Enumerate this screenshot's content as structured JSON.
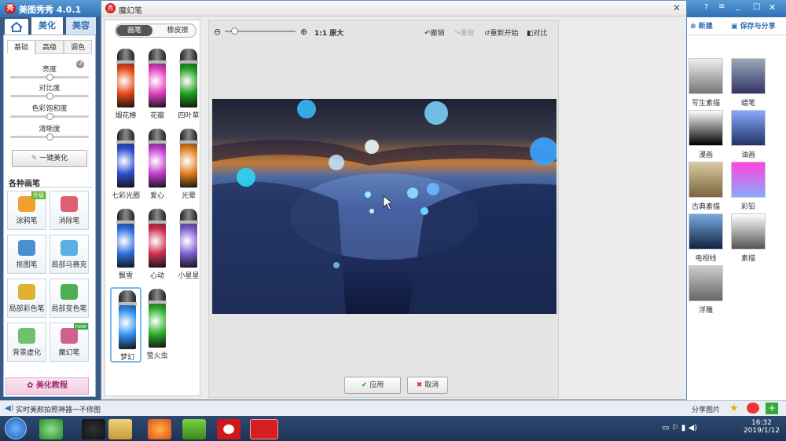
{
  "app": {
    "title": "美图秀秀 4.0.1",
    "logo_text": "秀"
  },
  "nav": {
    "tabs": [
      "美化",
      "美容"
    ]
  },
  "left": {
    "subtabs": [
      "基础",
      "高级",
      "调色"
    ],
    "sliders": [
      {
        "label": "亮度",
        "value": 0.5
      },
      {
        "label": "对比度",
        "value": 0.5
      },
      {
        "label": "色彩饱和度",
        "value": 0.5
      },
      {
        "label": "清晰度",
        "value": 0.5
      }
    ],
    "one_click": "一键美化",
    "section_title": "各种画笔",
    "tools": [
      {
        "label": "涂鸦笔",
        "badge": "升级",
        "color": "#f0a030"
      },
      {
        "label": "消除笔",
        "color": "#e06070"
      },
      {
        "label": "抠图笔",
        "color": "#4a90d0"
      },
      {
        "label": "局部马赛克",
        "color": "#5ab0e0"
      },
      {
        "label": "局部彩色笔",
        "color": "#e0b030"
      },
      {
        "label": "局部变色笔",
        "color": "#50b050"
      },
      {
        "label": "背景虚化",
        "color": "#70c070"
      },
      {
        "label": "魔幻笔",
        "badge": "new",
        "color": "#d06090"
      }
    ],
    "tutorial": "美化教程"
  },
  "magic": {
    "title": "魔幻笔",
    "mode_tabs": [
      "画笔",
      "橡皮擦"
    ],
    "pens": [
      {
        "label": "烟花棒",
        "color": "#e64a1a"
      },
      {
        "label": "花瓣",
        "color": "#e040c0"
      },
      {
        "label": "四叶草",
        "color": "#20a020"
      },
      {
        "label": "七彩光圈",
        "color": "#3050d0"
      },
      {
        "label": "爱心",
        "color": "#c040d0"
      },
      {
        "label": "光晕",
        "color": "#e08020"
      },
      {
        "label": "飘雪",
        "color": "#3070e0"
      },
      {
        "label": "心动",
        "color": "#d03050"
      },
      {
        "label": "小星星",
        "color": "#8060d0"
      },
      {
        "label": "梦幻",
        "color": "#3090f0"
      },
      {
        "label": "萤火虫",
        "color": "#30b030"
      }
    ],
    "zoom_label": "1:1 原大",
    "undo": "撤销",
    "redo": "重做",
    "restart": "重新开始",
    "compare": "对比",
    "apply": "应用",
    "cancel": "取消"
  },
  "right": {
    "new_label": "新建",
    "save_label": "保存与分享",
    "effects": [
      "写生素描",
      "蜡笔",
      "漫画",
      "油画",
      "古典素描",
      "彩铅",
      "电视线",
      "素描",
      "浮雕"
    ],
    "share_label": "分享图片"
  },
  "status": {
    "text": "实时美颜拍照神器一不修图"
  },
  "taskbar": {
    "time": "16:32",
    "date": "2019/1/12"
  }
}
